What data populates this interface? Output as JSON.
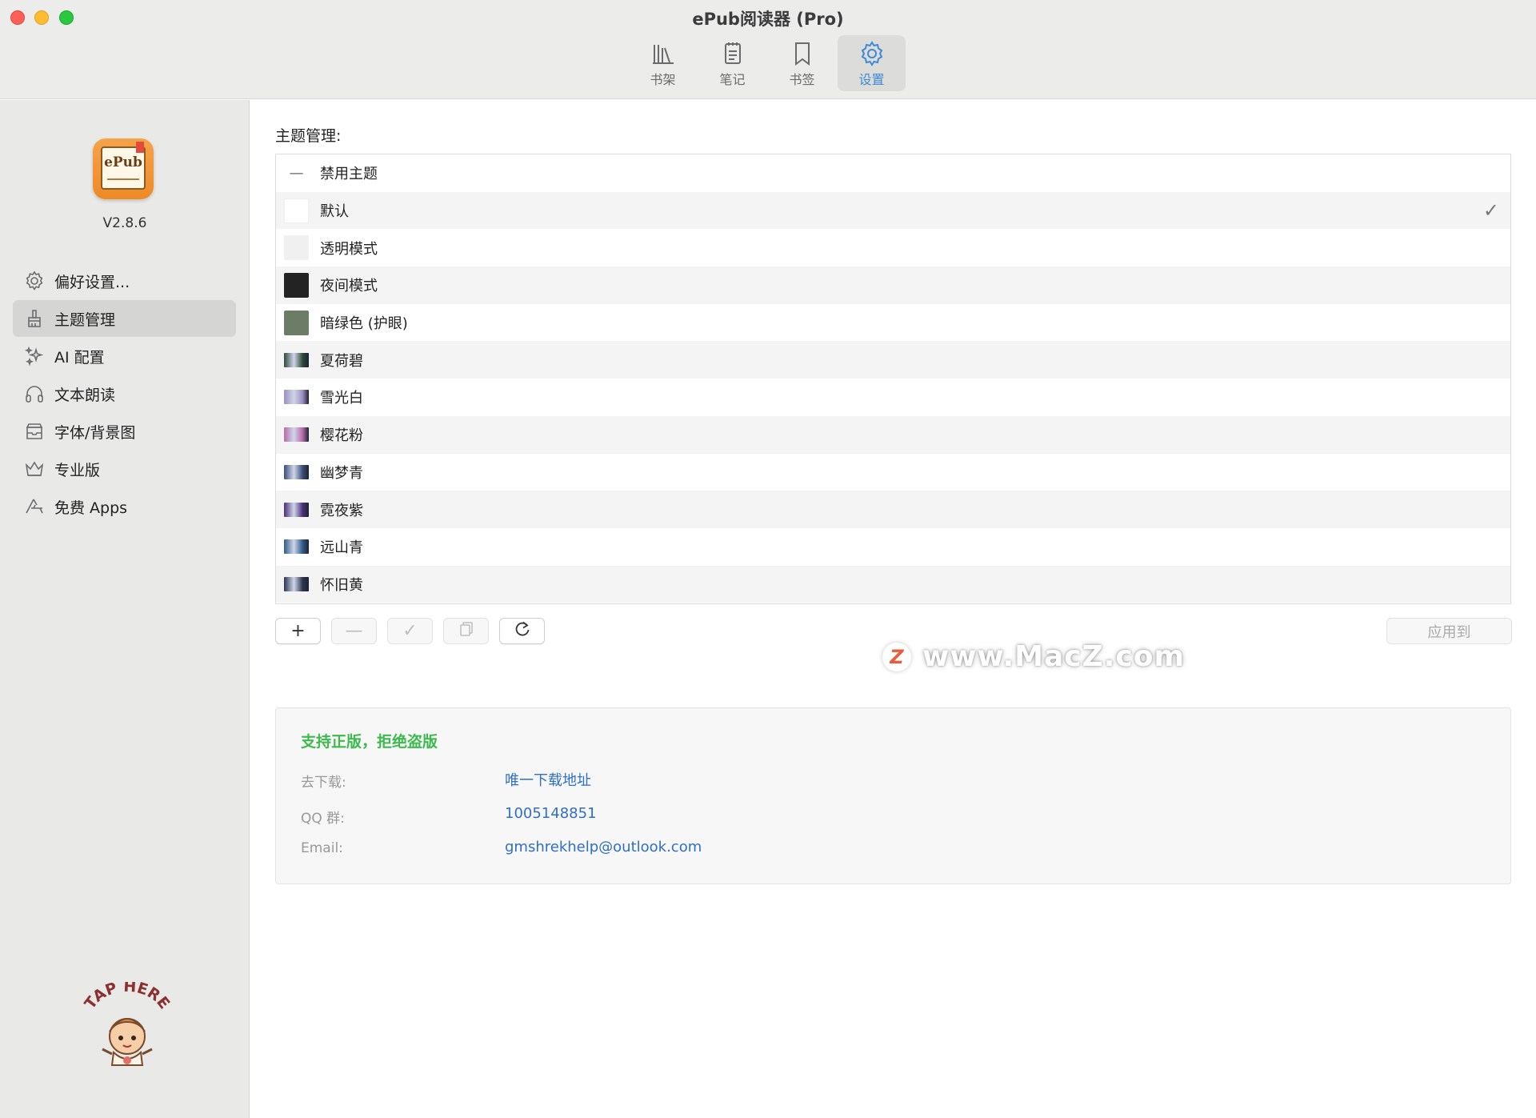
{
  "window": {
    "title": "ePub阅读器 (Pro)"
  },
  "toolbar": {
    "tabs": [
      {
        "label": "书架",
        "icon": "bookshelf-icon",
        "active": false
      },
      {
        "label": "笔记",
        "icon": "notes-icon",
        "active": false
      },
      {
        "label": "书签",
        "icon": "bookmark-icon",
        "active": false
      },
      {
        "label": "设置",
        "icon": "gear-icon",
        "active": true
      }
    ]
  },
  "sidebar": {
    "app_icon_text": "ePub",
    "version": "V2.8.6",
    "items": [
      {
        "label": "偏好设置...",
        "icon": "gear-icon",
        "active": false
      },
      {
        "label": "主题管理",
        "icon": "brush-icon",
        "active": true
      },
      {
        "label": "AI 配置",
        "icon": "sparkles-icon",
        "active": false
      },
      {
        "label": "文本朗读",
        "icon": "headphones-icon",
        "active": false
      },
      {
        "label": "字体/背景图",
        "icon": "tray-icon",
        "active": false
      },
      {
        "label": "专业版",
        "icon": "crown-icon",
        "active": false
      },
      {
        "label": "免费 Apps",
        "icon": "app-store-icon",
        "active": false
      }
    ],
    "mascot_text": "TAP HERE"
  },
  "main": {
    "section_label": "主题管理:",
    "themes": [
      {
        "name": "禁用主题",
        "swatch": "dash",
        "selected": false
      },
      {
        "name": "默认",
        "swatch": "#ffffff",
        "selected": true
      },
      {
        "name": "透明模式",
        "swatch": "#f0f0f0",
        "selected": false
      },
      {
        "name": "夜间模式",
        "swatch": "#232323",
        "selected": false
      },
      {
        "name": "暗绿色 (护眼)",
        "swatch": "#6d7c66",
        "selected": false
      },
      {
        "name": "夏荷碧",
        "swatch": "#2d4a3a",
        "selected": false
      },
      {
        "name": "雪光白",
        "swatch": "#9a8fc0",
        "selected": false
      },
      {
        "name": "樱花粉",
        "swatch": "#b86aa8",
        "selected": false
      },
      {
        "name": "幽梦青",
        "swatch": "#3a4d7a",
        "selected": false
      },
      {
        "name": "霓夜紫",
        "swatch": "#4a2f7a",
        "selected": false
      },
      {
        "name": "远山青",
        "swatch": "#2f5a88",
        "selected": false
      },
      {
        "name": "怀旧黄",
        "swatch": "#2c3550",
        "selected": false
      }
    ],
    "check_symbol": "✓",
    "buttons": {
      "add": "+",
      "remove": "—",
      "apply_check": "✓",
      "copy_icon": "copy-icon",
      "refresh_icon": "refresh-icon",
      "apply_to": "应用到"
    },
    "info": {
      "title": "支持正版，拒绝盗版",
      "download_key": "去下载:",
      "download_val": "唯一下载地址",
      "qq_key": "QQ 群:",
      "qq_val": "1005148851",
      "email_key": "Email:",
      "email_val": "gmshrekhelp@outlook.com"
    },
    "watermark": {
      "logo": "Z",
      "text": "www.MacZ.com"
    }
  },
  "colors": {
    "accent": "#3e8ad6",
    "support_green": "#3dba4e",
    "link_blue": "#2f6fc4"
  }
}
